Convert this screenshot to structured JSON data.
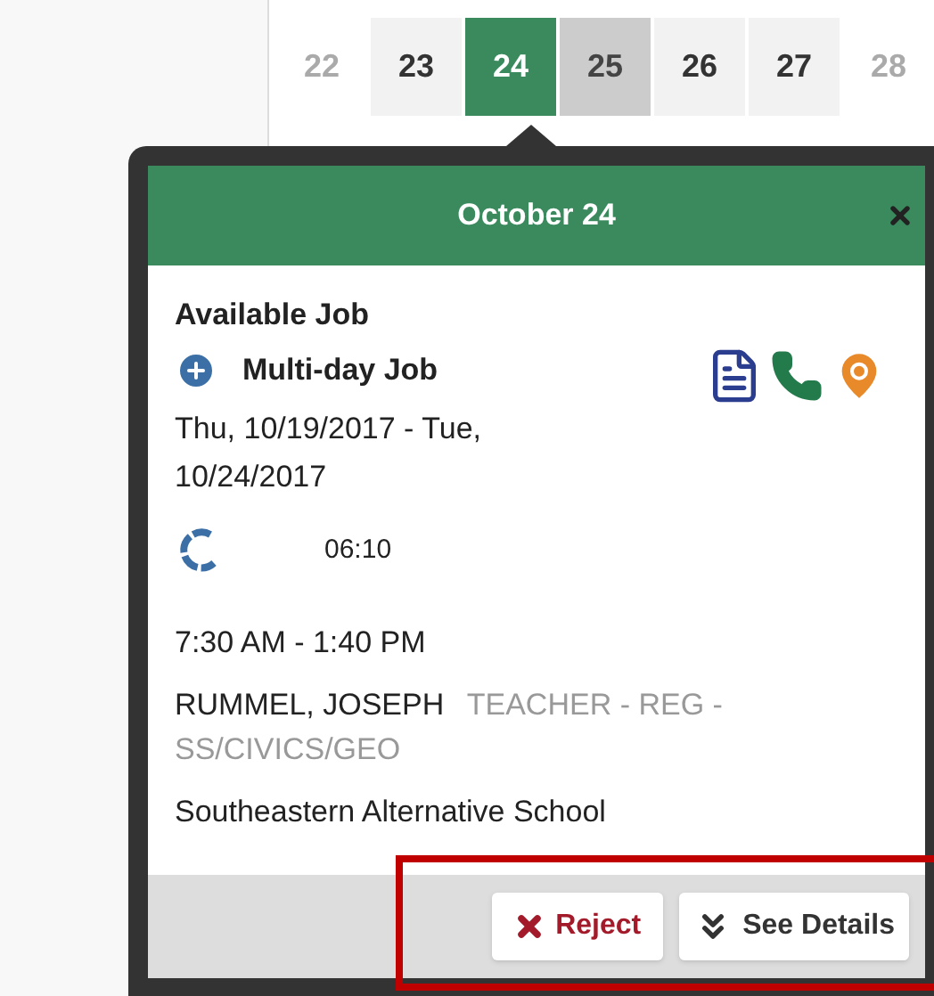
{
  "calendar": {
    "days": [
      {
        "label": "22",
        "selected": false,
        "kind": "outside"
      },
      {
        "label": "23",
        "selected": false,
        "kind": "normal"
      },
      {
        "label": "24",
        "selected": true,
        "kind": "normal"
      },
      {
        "label": "25",
        "selected": false,
        "kind": "booked"
      },
      {
        "label": "26",
        "selected": false,
        "kind": "normal"
      },
      {
        "label": "27",
        "selected": false,
        "kind": "normal"
      },
      {
        "label": "28",
        "selected": false,
        "kind": "outside"
      }
    ]
  },
  "popover": {
    "title": "October 24",
    "status": "Available Job",
    "job_type": "Multi-day Job",
    "dates": "Thu, 10/19/2017 - Tue, 10/24/2017",
    "duration": "06:10",
    "time": "7:30 AM - 1:40 PM",
    "person": "RUMMEL, JOSEPH",
    "position": "TEACHER - REG - SS/CIVICS/GEO",
    "school": "Southeastern Alternative School",
    "buttons": [
      {
        "label": "Reject",
        "kind": "reject"
      },
      {
        "label": "See Details",
        "kind": "details"
      }
    ]
  }
}
